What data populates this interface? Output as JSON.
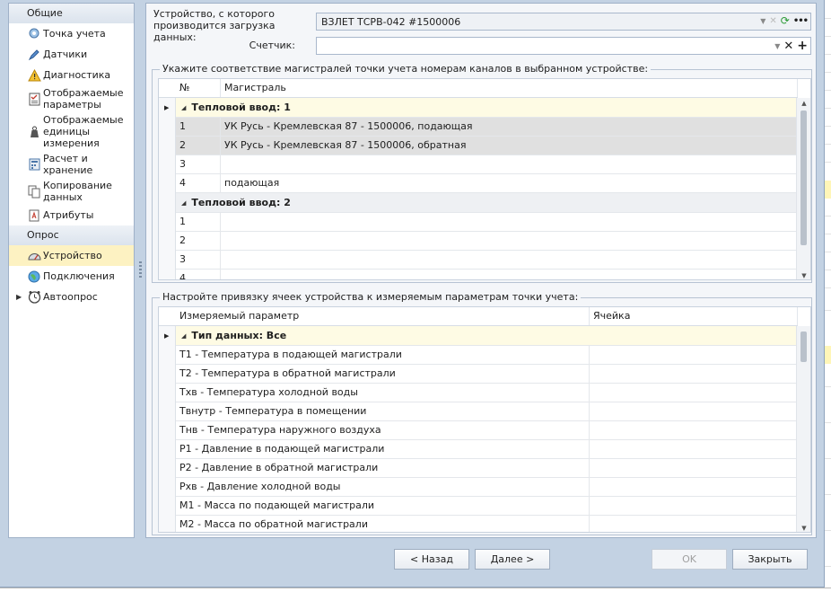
{
  "nav": {
    "groups": [
      {
        "label": "Общие"
      },
      {
        "label": "Опрос"
      }
    ],
    "items": [
      {
        "label": "Точка учета",
        "icon": "location-pin-icon"
      },
      {
        "label": "Датчики",
        "icon": "pen-sensor-icon"
      },
      {
        "label": "Диагностика",
        "icon": "warning-icon"
      },
      {
        "label": "Отображаемые параметры",
        "icon": "checklist-icon"
      },
      {
        "label": "Отображаемые единицы измерения",
        "icon": "weight-icon"
      },
      {
        "label": "Расчет и хранение",
        "icon": "calculator-icon"
      },
      {
        "label": "Копирование данных",
        "icon": "copy-icon"
      },
      {
        "label": "Атрибуты",
        "icon": "document-attribute-icon"
      },
      {
        "label": "Устройство",
        "icon": "gauge-icon"
      },
      {
        "label": "Подключения",
        "icon": "globe-icon"
      },
      {
        "label": "Автоопрос",
        "icon": "clock-icon"
      }
    ]
  },
  "form": {
    "device_label": "Устройство, с которого производится загрузка данных:",
    "device_value": "ВЗЛЕТ ТСРВ-042 #1500006",
    "counter_label": "Счетчик:",
    "counter_value": ""
  },
  "mains_grid": {
    "title": "Укажите соответствие магистралей точки учета номерам каналов в выбранном устройстве:",
    "col_num": "№",
    "col_main": "Магистраль",
    "group1": "Тепловой ввод: 1",
    "group1_rows": [
      {
        "num": "1",
        "main": "УК Русь - Кремлевская 87 - 1500006, подающая"
      },
      {
        "num": "2",
        "main": "УК Русь - Кремлевская 87 - 1500006, обратная"
      },
      {
        "num": "3",
        "main": ""
      },
      {
        "num": "4",
        "main": "подающая"
      }
    ],
    "group2": "Тепловой ввод: 2",
    "group2_rows": [
      {
        "num": "1",
        "main": ""
      },
      {
        "num": "2",
        "main": ""
      },
      {
        "num": "3",
        "main": ""
      },
      {
        "num": "4",
        "main": ""
      }
    ]
  },
  "params_grid": {
    "title": "Настройте привязку ячеек устройства к измеряемым параметрам точки учета:",
    "col_param": "Измеряемый параметр",
    "col_cell": "Ячейка",
    "group": "Тип данных: Все",
    "rows": [
      {
        "param": "T1 - Температура в подающей магистрали",
        "cell": ""
      },
      {
        "param": "T2 - Температура в обратной магистрали",
        "cell": ""
      },
      {
        "param": "Тхв - Температура холодной воды",
        "cell": ""
      },
      {
        "param": "Твнутр - Температура в помещении",
        "cell": ""
      },
      {
        "param": "Тнв - Температура наружного воздуха",
        "cell": ""
      },
      {
        "param": "P1 - Давление в подающей магистрали",
        "cell": ""
      },
      {
        "param": "P2 - Давление в обратной магистрали",
        "cell": ""
      },
      {
        "param": "Рхв - Давление холодной воды",
        "cell": ""
      },
      {
        "param": "M1 - Масса по подающей магистрали",
        "cell": ""
      },
      {
        "param": "M2 - Масса по обратной магистрали",
        "cell": ""
      }
    ]
  },
  "buttons": {
    "back": "< Назад",
    "next": "Далее >",
    "ok": "OK",
    "close": "Закрыть"
  }
}
